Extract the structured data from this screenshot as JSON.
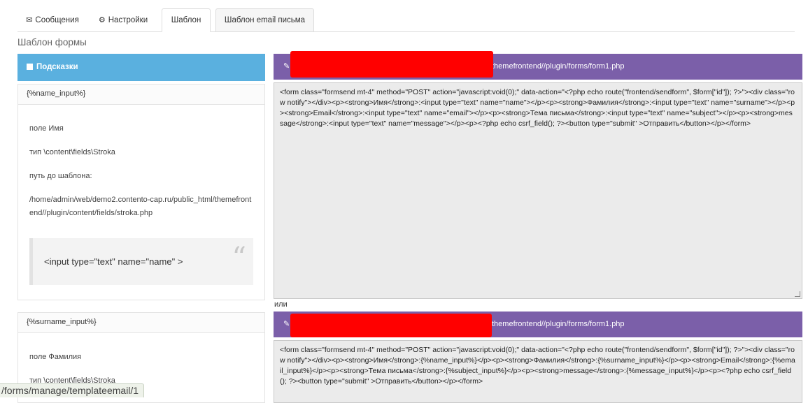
{
  "tabs": [
    {
      "label": "Сообщения",
      "icon": "envelope-icon"
    },
    {
      "label": "Настройки",
      "icon": "gear-icon"
    },
    {
      "label": "Шаблон"
    },
    {
      "label": "Шаблон email письма"
    }
  ],
  "section_title": "Шаблон формы",
  "hints": {
    "title": "Подсказки",
    "icon": "note-icon",
    "cards": [
      {
        "key": "{%name_input%}",
        "lines": [
          "поле Имя",
          "тип \\content\\fields\\Stroka",
          "путь до шаблона:",
          "/home/admin/web/demo2.contento-cap.ru/public_html/themefrontend//plugin/content/fields/stroka.php"
        ],
        "quote": "<input type=\"text\" name=\"name\" >",
        "quote_mark": "“"
      },
      {
        "key": "{%surname_input%}",
        "lines": [
          "поле Фамилия",
          "тип \\content\\fields\\Stroka"
        ]
      }
    ]
  },
  "editors": [
    {
      "path": "themefrontend//plugin/forms/form1.php",
      "code": "<form class=\"formsend mt-4\" method=\"POST\" action=\"javascript:void(0);\" data-action=\"<?php echo route(\"frontend/sendform\", $form[\"id\"]); ?>\"><div class=\"row notify\"></div><p><strong>Имя</strong>:<input type=\"text\" name=\"name\"></p><p><strong>Фамилия</strong>:<input type=\"text\" name=\"surname\"></p><p><strong>Email</strong>:<input type=\"text\" name=\"email\"></p><p><strong>Тема письма</strong>:<input type=\"text\" name=\"subject\"></p><p><strong>message</strong>:<input type=\"text\" name=\"message\"></p><p><?php echo csrf_field(); ?><button type=\"submit\" >Отправить</button></p></form>"
    },
    {
      "path": "themefrontend//plugin/forms/form1.php",
      "code": "<form class=\"formsend mt-4\" method=\"POST\" action=\"javascript:void(0);\" data-action=\"<?php echo route(\"frontend/sendform\", $form[\"id\"]); ?>\"><div class=\"row notify\"></div><p><strong>Имя</strong>:{%name_input%}</p><p><strong>Фамилия</strong>:{%surname_input%}</p><p><strong>Email</strong>:{%email_input%}</p><p><strong>Тема письма</strong>:{%subject_input%}</p><p><strong>message</strong>:{%message_input%}</p><p><?php echo csrf_field(); ?><button type=\"submit\"  >Отправить</button></p></form>"
    }
  ],
  "or_label": "или",
  "status_url": "/forms/manage/templateemail/1",
  "colors": {
    "hints_header": "#5ab0df",
    "editor_header": "#7b5fa9",
    "redaction": "#ff0000"
  }
}
